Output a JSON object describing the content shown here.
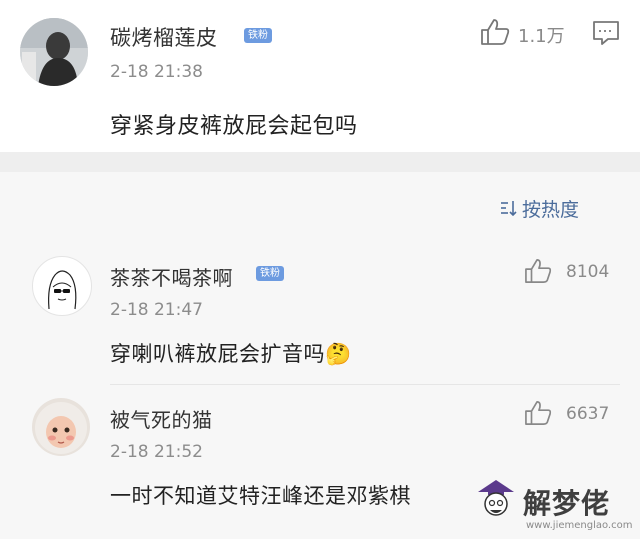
{
  "post": {
    "username": "碳烤榴莲皮",
    "badge": "铁粉",
    "time": "2-18 21:38",
    "text": "穿紧身皮裤放屁会起包吗",
    "like_count": "1.1万",
    "icons": [
      "thumbs-up-icon",
      "comment-icon"
    ]
  },
  "sort": {
    "label": "按热度",
    "icon": "sort-icon"
  },
  "comments": [
    {
      "username": "茶茶不喝茶啊",
      "badge": "铁粉",
      "time": "2-18 21:47",
      "text": "穿喇叭裤放屁会扩音吗",
      "emoji": "🤔",
      "likes": "8104"
    },
    {
      "username": "被气死的猫",
      "badge": "",
      "time": "2-18 21:52",
      "text": "一时不知道艾特汪峰还是邓紫棋",
      "likes": "6637"
    }
  ],
  "watermark": {
    "brand": "解梦佬",
    "url": "www.jiemenglao.com"
  },
  "colors": {
    "badge": "#6d9be0",
    "sort": "#4b6c9b",
    "gap": "#eeeeee",
    "comments_bg": "#f7f7f7"
  }
}
